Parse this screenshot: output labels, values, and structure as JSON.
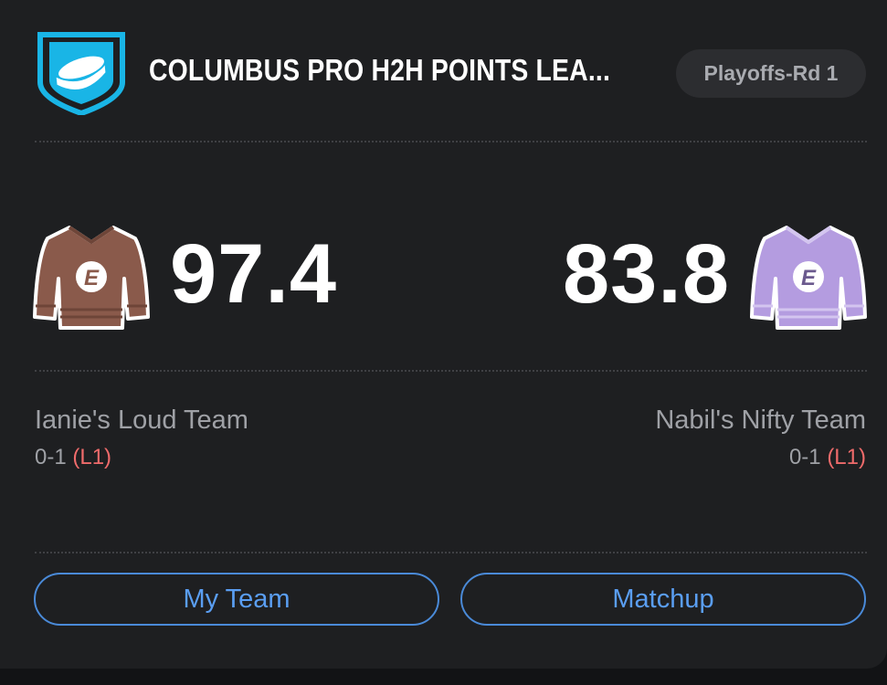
{
  "header": {
    "league_name": "COLUMBUS PRO H2H POINTS LEA...",
    "round_badge": "Playoffs-Rd 1",
    "logo_icon": "hockey-puck-shield-icon",
    "logo_color": "#19b5e6"
  },
  "matchup": {
    "home": {
      "score": "97.4",
      "team_name": "Ianie's Loud Team",
      "record": "0-1",
      "streak": "(L1)",
      "jersey_icon": "hockey-jersey-icon",
      "jersey_color": "#8a5a4b"
    },
    "away": {
      "score": "83.8",
      "team_name": "Nabil's Nifty Team",
      "record": "0-1",
      "streak": "(L1)",
      "jersey_icon": "hockey-jersey-icon",
      "jersey_color": "#b49ce0"
    }
  },
  "actions": {
    "my_team_label": "My Team",
    "matchup_label": "Matchup"
  },
  "colors": {
    "background": "#1e1f21",
    "accent": "#5a9ef2",
    "loss": "#ef6b6b"
  }
}
